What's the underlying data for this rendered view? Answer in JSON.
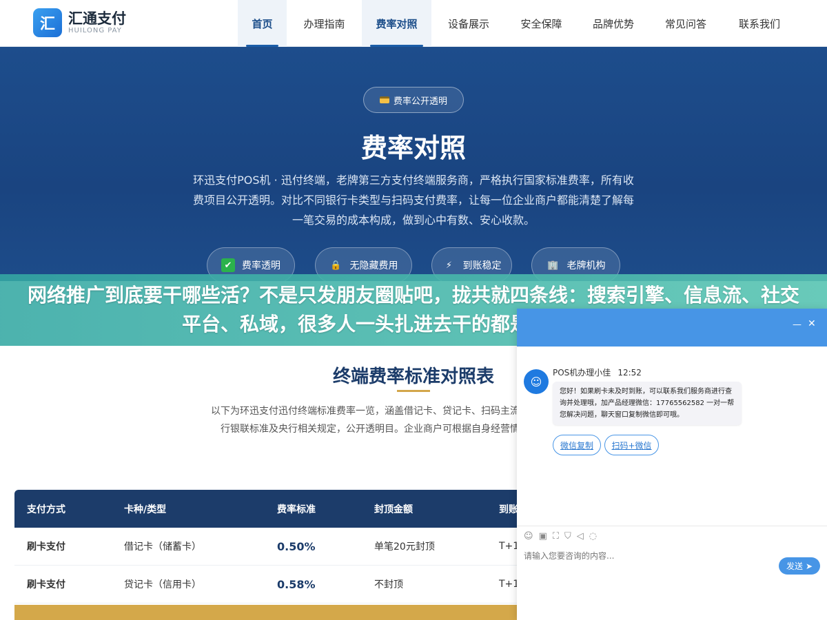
{
  "brand": {
    "mark": "汇",
    "name": "汇通支付",
    "sub": "HUILONG PAY"
  },
  "nav": [
    {
      "label": "首页",
      "active": true
    },
    {
      "label": "办理指南",
      "active": false
    },
    {
      "label": "费率对照",
      "active": true
    },
    {
      "label": "设备展示",
      "active": false
    },
    {
      "label": "安全保障",
      "active": false
    },
    {
      "label": "品牌优势",
      "active": false
    },
    {
      "label": "常见问答",
      "active": false
    },
    {
      "label": "联系我们",
      "active": false
    }
  ],
  "hero": {
    "badge": "费率公开透明",
    "title": "费率对照",
    "desc": "环迅支付POS机 · 迅付终端，老牌第三方支付终端服务商，严格执行国家标准费率，所有收费项目公开透明。对比不同银行卡类型与扫码支付费率，让每一位企业商户都能清楚了解每一笔交易的成本构成，做到心中有数、安心收款。",
    "pills": [
      {
        "icon": "✔",
        "label": "费率透明"
      },
      {
        "icon": "🔒",
        "label": "无隐藏费用"
      },
      {
        "icon": "⚡",
        "label": "到账稳定"
      },
      {
        "icon": "🏢",
        "label": "老牌机构"
      }
    ]
  },
  "banner": {
    "text": "网络推广到底要干哪些活？不是只发朋友圈贴吧，拢共就四条线：搜索引擎、信息流、社交平台、私域，很多人一头扎进去干的都是最不赚钱的那"
  },
  "section": {
    "title": "终端费率标准对照表",
    "desc": "以下为环迅支付迅付终端标准费率一览，涵盖借记卡、贷记卡、扫码主流支付方式。费率严格执行银联标准及央行相关规定，公开透明目。企业商户可根据自身经营情况选择最适合的收款"
  },
  "table": {
    "headers": [
      "支付方式",
      "卡种/类型",
      "费率标准",
      "封顶金额",
      "到账"
    ],
    "rows": [
      [
        "刷卡支付",
        "借记卡（储蓄卡）",
        "0.50%",
        "单笔20元封顶",
        "T+1"
      ],
      [
        "刷卡支付",
        "贷记卡（信用卡）",
        "0.58%",
        "不封顶",
        "T+1"
      ]
    ]
  },
  "chat": {
    "minimize": "—",
    "close": "✕",
    "agent": "POS机办理小佳",
    "time": "12:52",
    "message": "您好！如果刷卡未及时到账，可以联系我们服务商进行查询并处理哦，加产品经理微信：17765562582 一对一帮您解决问题，聊天窗口复制微信即可哦。",
    "buttons": [
      "微信复制",
      "扫码+微信"
    ],
    "input_placeholder": "请输入您要咨询的内容...",
    "send": "发送"
  },
  "colors": {
    "primary": "#1c3c6a",
    "accent": "#4795e6",
    "gold": "#d4a84a",
    "banner": "#3bb0a8"
  }
}
